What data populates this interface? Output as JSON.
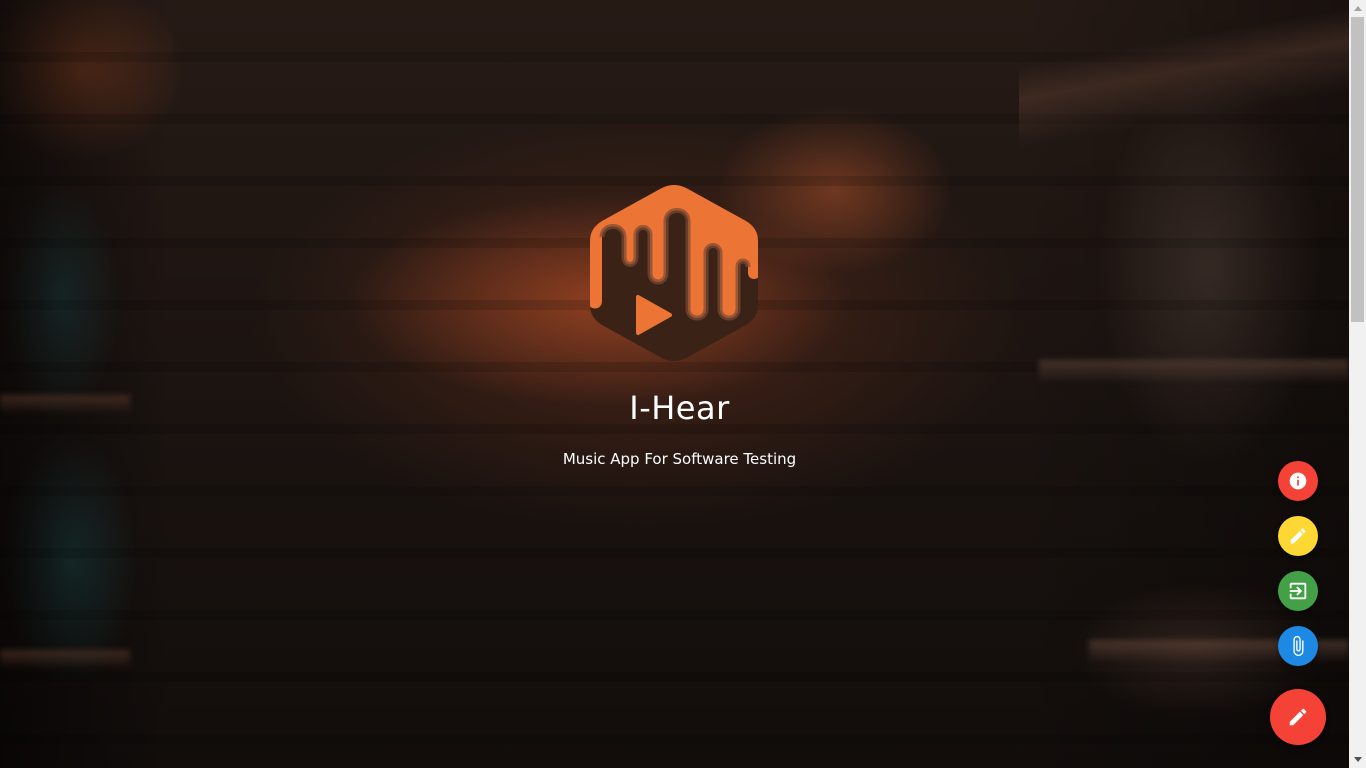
{
  "app": {
    "title": "I-Hear",
    "subtitle": "Music App For Software Testing"
  },
  "logo": {
    "icon": "music-play-hexagon-icon",
    "colors": {
      "orange": "#ec7434",
      "dark": "#3b2217"
    }
  },
  "fab_menu": {
    "actions": [
      {
        "icon": "info-icon",
        "color": "#f44336"
      },
      {
        "icon": "pencil-icon",
        "color": "#fdd835"
      },
      {
        "icon": "login-icon",
        "color": "#43a047"
      },
      {
        "icon": "paperclip-icon",
        "color": "#1e88e5"
      }
    ],
    "main": {
      "icon": "pencil-icon",
      "color": "#f44336"
    }
  },
  "scrollbar": {
    "track_color": "#f1f1f1",
    "thumb_color": "#c1c1c1"
  }
}
